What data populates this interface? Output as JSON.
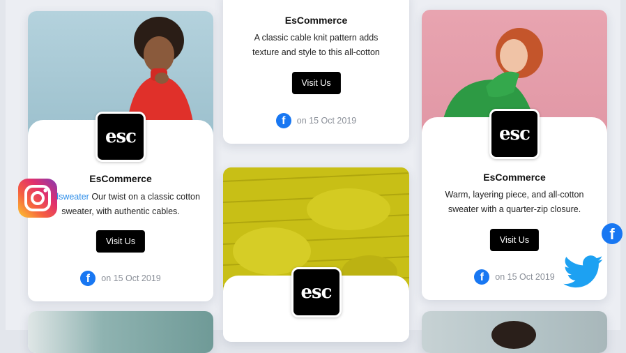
{
  "brand": "EsCommerce",
  "logo_text": "esc",
  "visit_label": "Visit Us",
  "cards": [
    {
      "description_tag": "#redsweater",
      "description": "Our twist on a classic cotton sweater, with authentic cables.",
      "date": "on 15 Oct 2019"
    },
    {
      "description": "A classic cable knit pattern adds texture and style to this all-cotton",
      "date": "on 15 Oct 2019"
    },
    {
      "description": "Warm, layering piece, and all-cotton sweater with a quarter-zip closure.",
      "date": "on 15 Oct 2019"
    }
  ],
  "icons": {
    "facebook": "facebook-icon",
    "instagram": "instagram-icon",
    "twitter": "twitter-icon"
  },
  "colors": {
    "accent_link": "#2c8de8",
    "facebook": "#1877f2",
    "twitter": "#1da1f2",
    "button": "#000000"
  }
}
